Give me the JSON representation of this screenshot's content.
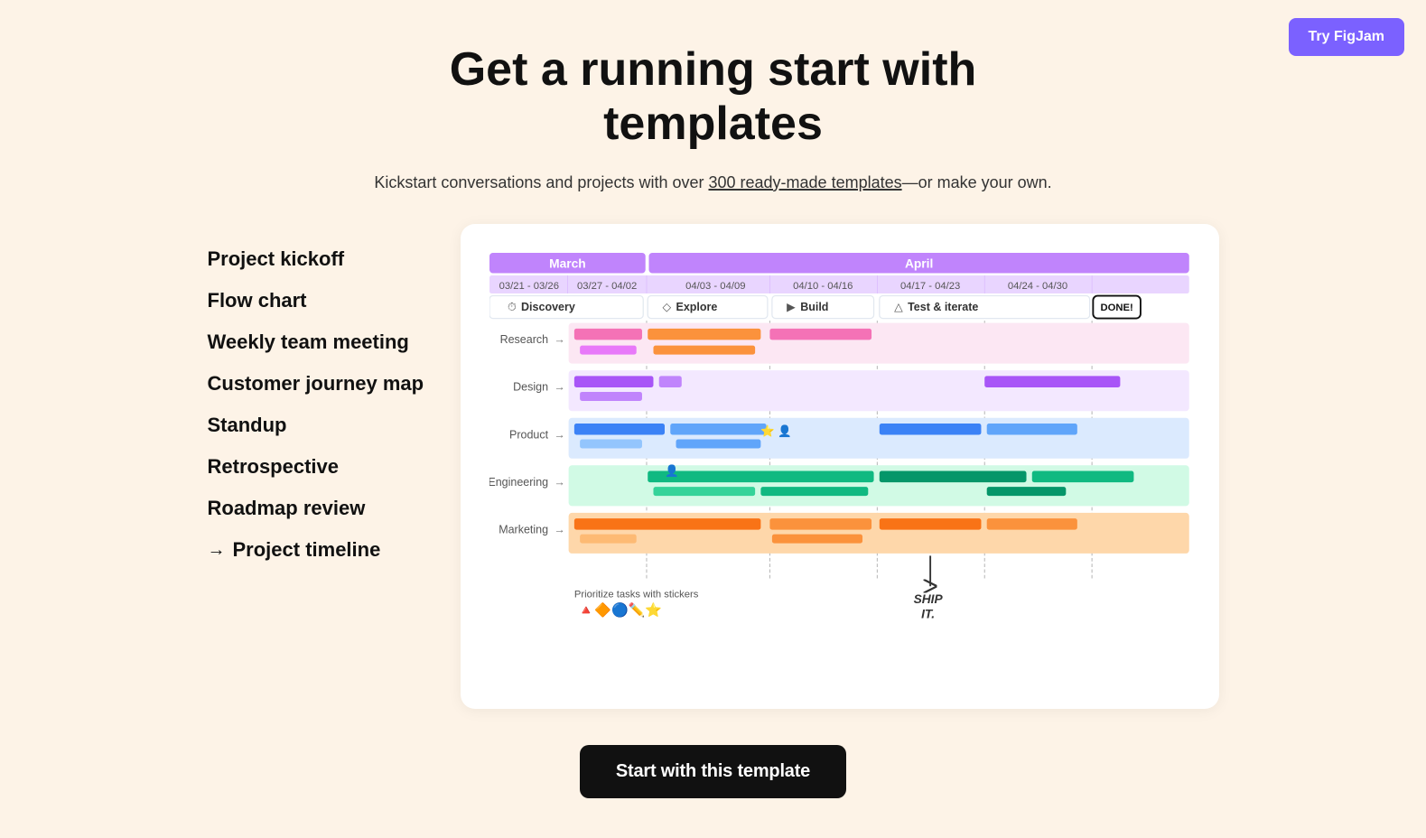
{
  "page": {
    "title": "Get a running start with templates",
    "subtitle_part1": "Kickstart conversations and projects with over ",
    "subtitle_link": "300 ready-made templates",
    "subtitle_part2": "—or make your own."
  },
  "try_button": {
    "label": "Try FigJam"
  },
  "sidebar": {
    "items": [
      {
        "id": "project-kickoff",
        "label": "Project kickoff",
        "active": false,
        "arrow": false
      },
      {
        "id": "flow-chart",
        "label": "Flow chart",
        "active": false,
        "arrow": false
      },
      {
        "id": "weekly-team-meeting",
        "label": "Weekly team meeting",
        "active": false,
        "arrow": false
      },
      {
        "id": "customer-journey-map",
        "label": "Customer journey map",
        "active": false,
        "arrow": false
      },
      {
        "id": "standup",
        "label": "Standup",
        "active": false,
        "arrow": false
      },
      {
        "id": "retrospective",
        "label": "Retrospective",
        "active": false,
        "arrow": false
      },
      {
        "id": "roadmap-review",
        "label": "Roadmap review",
        "active": false,
        "arrow": false
      },
      {
        "id": "project-timeline",
        "label": "Project timeline",
        "active": true,
        "arrow": true
      }
    ]
  },
  "preview": {
    "months": [
      {
        "label": "March",
        "weeks": [
          "03/21 - 03/26",
          "03/27 - 04/02"
        ]
      },
      {
        "label": "April",
        "weeks": [
          "04/03 - 04/09",
          "04/10 - 04/16",
          "04/17 - 04/23",
          "04/24 - 04/30"
        ]
      }
    ],
    "phases": [
      {
        "icon": "⏱",
        "label": "Discovery"
      },
      {
        "icon": "◇",
        "label": "Explore"
      },
      {
        "icon": "▶",
        "label": "Build"
      },
      {
        "icon": "△",
        "label": "Test & iterate"
      },
      {
        "icon": "✓",
        "label": "DONE!"
      }
    ],
    "rows": [
      {
        "label": "Research"
      },
      {
        "label": "Design"
      },
      {
        "label": "Product"
      },
      {
        "label": "Engineering"
      },
      {
        "label": "Marketing"
      }
    ],
    "sticker_label": "Prioritize tasks with stickers",
    "ship_label": "SHIP IT."
  },
  "cta": {
    "label": "Start with this template"
  }
}
